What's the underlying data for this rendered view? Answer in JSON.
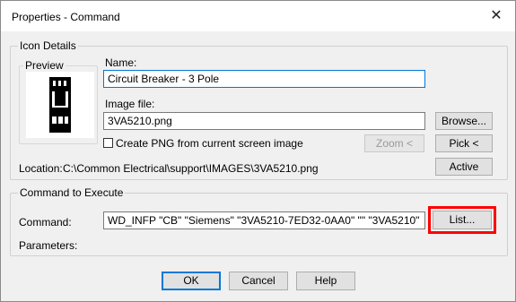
{
  "window": {
    "title": "Properties - Command",
    "close_glyph": "✕"
  },
  "icon_details": {
    "legend": "Icon Details",
    "preview_label": "Preview",
    "name_label": "Name:",
    "name_value": "Circuit Breaker - 3 Pole",
    "image_file_label": "Image file:",
    "image_file_value": "3VA5210.png",
    "browse_label": "Browse...",
    "create_png_label": "Create PNG from current screen image",
    "create_png_checked": false,
    "zoom_label": "Zoom <",
    "pick_label": "Pick <",
    "location_label": "Location:",
    "location_value": "C:\\Common Electrical\\support\\IMAGES\\3VA5210.png",
    "active_label": "Active"
  },
  "command_to_execute": {
    "legend": "Command to Execute",
    "command_label": "Command:",
    "command_value": "WD_INFP \"CB\" \"Siemens\" \"3VA5210-7ED32-0AA0\" \"\" \"3VA5210\"",
    "list_label": "List...",
    "parameters_label": "Parameters:"
  },
  "footer": {
    "ok_label": "OK",
    "cancel_label": "Cancel",
    "help_label": "Help"
  },
  "colors": {
    "accent": "#0078d7",
    "highlight": "#ff0000",
    "dialog_bg": "#f0f0f0"
  }
}
